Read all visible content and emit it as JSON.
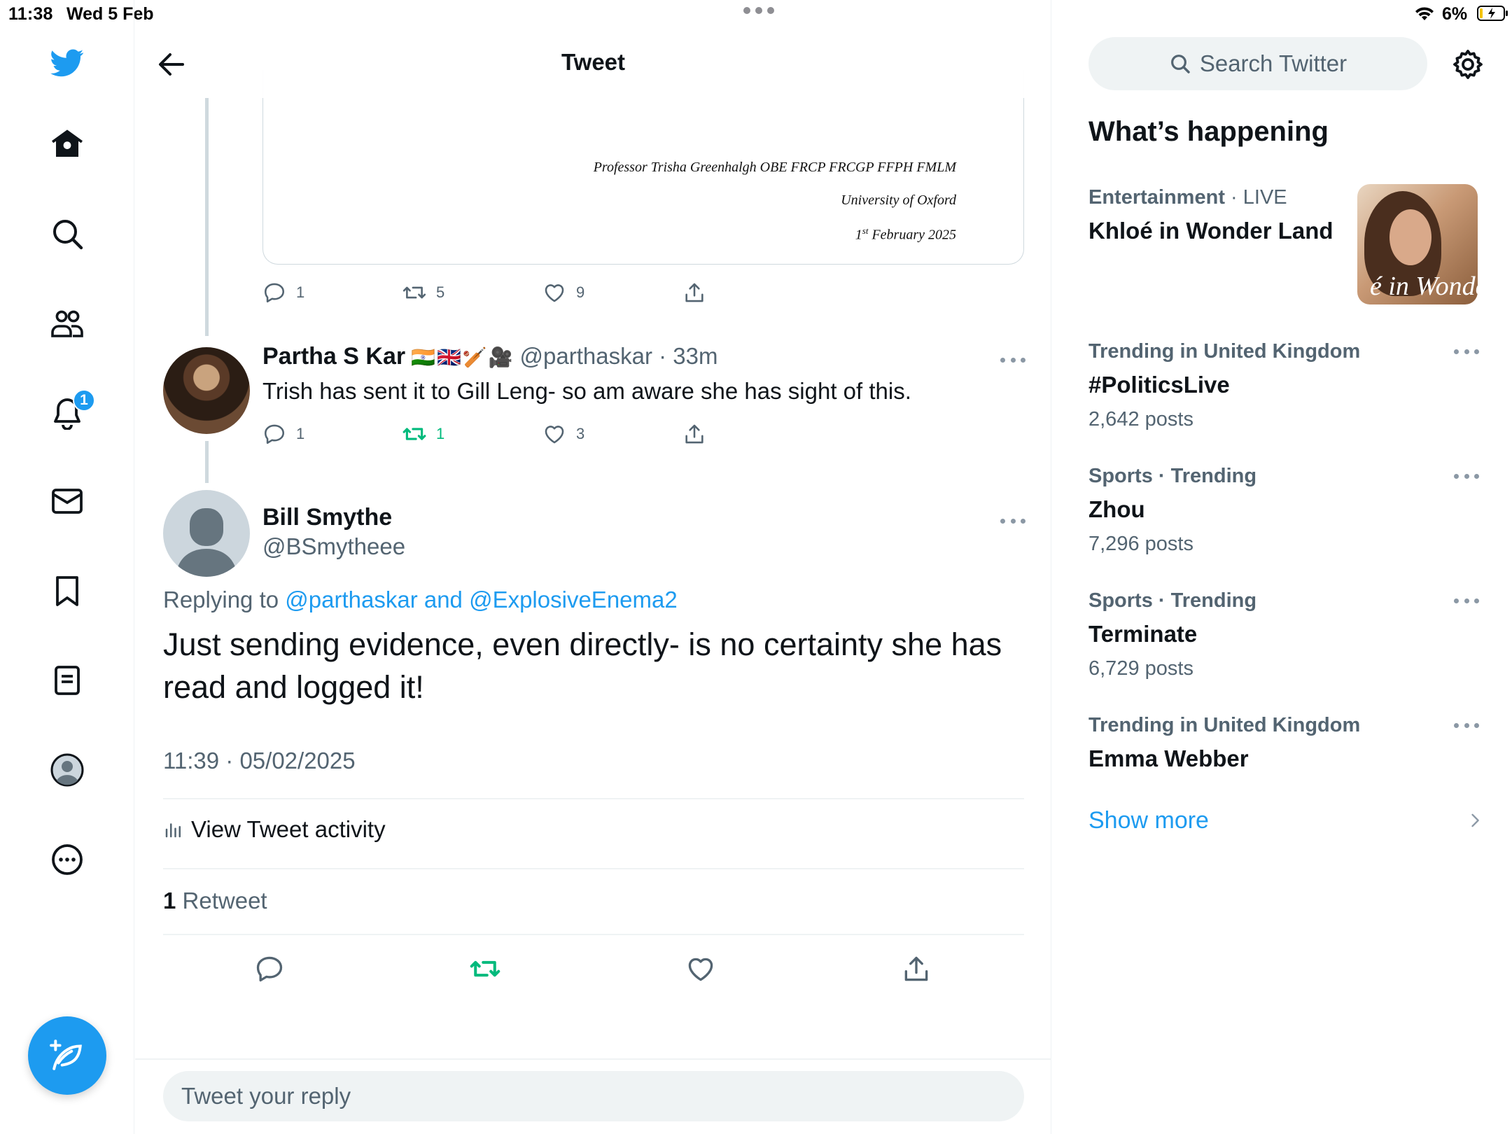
{
  "status_bar": {
    "time": "11:38",
    "date": "Wed 5 Feb",
    "battery": "6%"
  },
  "nav": {
    "notifications_badge": "1",
    "icons": [
      "twitter-bird-icon",
      "home-icon",
      "search-icon",
      "communities-icon",
      "bell-icon",
      "mail-icon",
      "bookmark-icon",
      "lists-icon",
      "profile-icon",
      "more-icon",
      "compose-icon"
    ],
    "accent_color": "#1d9bf0"
  },
  "header": {
    "title": "Tweet"
  },
  "quoted_document": {
    "line1": "Professor Trisha Greenhalgh OBE FRCP FRCGP FFPH FMLM",
    "line2": "University of Oxford",
    "line3_day": "1",
    "line3_sup": "st",
    "line3_rest": " February 2025"
  },
  "parent_tweet": {
    "reply_count": "1",
    "retweet_count": "5",
    "like_count": "9"
  },
  "reply_tweet": {
    "name": "Partha S Kar",
    "flags": "🇮🇳🇬🇧🏏🎥",
    "handle_time": "@parthaskar · 33m",
    "text": "Trish has sent it to Gill Leng- so am aware she has sight of this.",
    "reply_count": "1",
    "retweet_count": "1",
    "like_count": "3"
  },
  "focal_tweet": {
    "name": "Bill Smythe",
    "handle": "@BSmytheee",
    "replying_prefix": "Replying to ",
    "replying_mentions": "@parthaskar and @ExplosiveEnema2",
    "text": "Just sending evidence, even directly- is no certainty she has read and logged it!",
    "timestamp": "11:39 · 05/02/2025",
    "activity_label": "View Tweet activity",
    "retweets_number": "1",
    "retweets_label": " Retweet"
  },
  "reply_bar": {
    "placeholder": "Tweet your reply"
  },
  "sidebar": {
    "search_placeholder": "Search Twitter",
    "section_title": "What’s happening",
    "trends": [
      {
        "meta": "Entertainment",
        "meta_extra": " · LIVE",
        "title": "Khloé in Wonder Land",
        "count": ""
      },
      {
        "meta": "Trending in United Kingdom",
        "meta_extra": "",
        "title": "#PoliticsLive",
        "count": "2,642 posts"
      },
      {
        "meta": "Sports · Trending",
        "meta_extra": "",
        "title": "Zhou",
        "count": "7,296 posts"
      },
      {
        "meta": "Sports · Trending",
        "meta_extra": "",
        "title": "Terminate",
        "count": "6,729 posts"
      },
      {
        "meta": "Trending in United Kingdom",
        "meta_extra": "",
        "title": "Emma Webber",
        "count": ""
      }
    ],
    "trend_image_caption": "é in Wonder L",
    "show_more": "Show more"
  }
}
